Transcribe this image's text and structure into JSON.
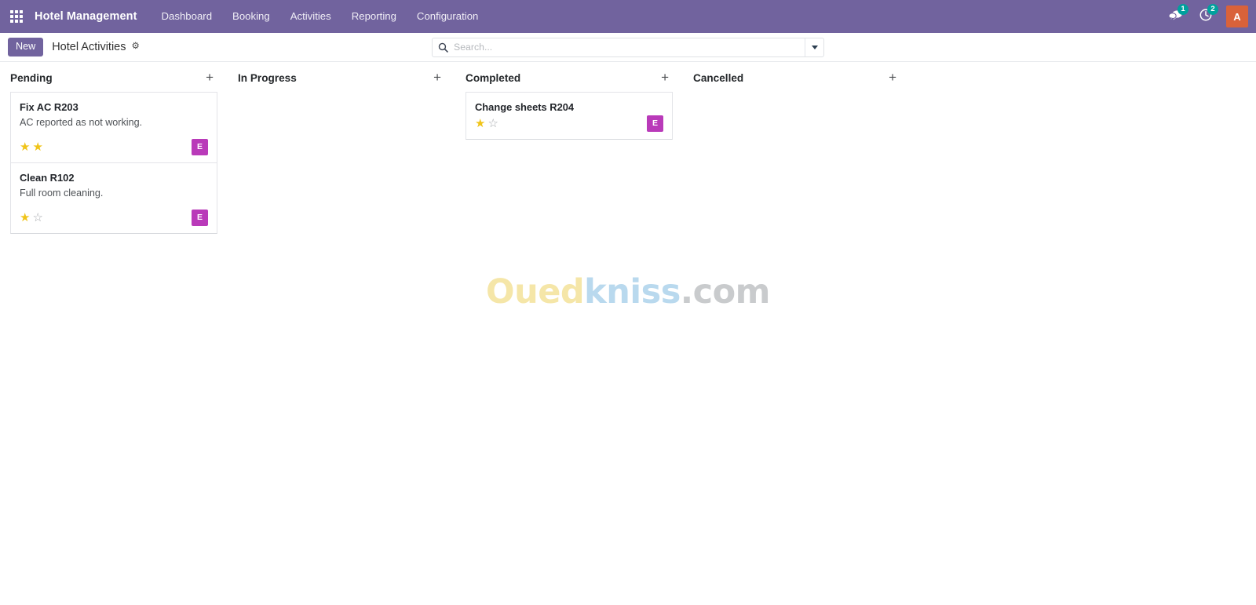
{
  "navbar": {
    "apps_icon": "apps-grid-icon",
    "brand": "Hotel Management",
    "menu": [
      {
        "label": "Dashboard"
      },
      {
        "label": "Booking"
      },
      {
        "label": "Activities"
      },
      {
        "label": "Reporting"
      },
      {
        "label": "Configuration"
      }
    ],
    "systray": {
      "messages": {
        "icon": "speech-bubble-icon",
        "count": "1"
      },
      "activities": {
        "icon": "clock-icon",
        "count": "2"
      },
      "user_avatar": "A"
    },
    "background_color": "#71639e",
    "badge_color": "#00a09d",
    "avatar_color": "#d9623a"
  },
  "control_panel": {
    "new_button": "New",
    "breadcrumb": "Hotel Activities",
    "gear_icon": "gear-icon",
    "search": {
      "icon": "search-icon",
      "value": "",
      "placeholder": "Search...",
      "toggle_icon": "chevron-down-icon"
    }
  },
  "kanban": {
    "columns": [
      {
        "title": "Pending",
        "add_icon": "plus-icon",
        "cards": [
          {
            "title": "Fix AC R203",
            "description": "AC reported as not working.",
            "stars_filled": 2,
            "stars_total": 2,
            "avatar": "E"
          },
          {
            "title": "Clean R102",
            "description": "Full room cleaning.",
            "stars_filled": 1,
            "stars_total": 2,
            "avatar": "E"
          }
        ]
      },
      {
        "title": "In Progress",
        "add_icon": "plus-icon",
        "cards": []
      },
      {
        "title": "Completed",
        "add_icon": "plus-icon",
        "cards": [
          {
            "title": "Change sheets R204",
            "description": "",
            "stars_filled": 1,
            "stars_total": 2,
            "avatar": "E"
          }
        ]
      },
      {
        "title": "Cancelled",
        "add_icon": "plus-icon",
        "cards": []
      }
    ],
    "card_avatar_color": "#b93ab9",
    "star_on_color": "#f0c419",
    "star_off_color": "#a6a9ad"
  },
  "watermark": {
    "part1": "Oued",
    "part2": "kniss",
    "part3": ".com"
  }
}
